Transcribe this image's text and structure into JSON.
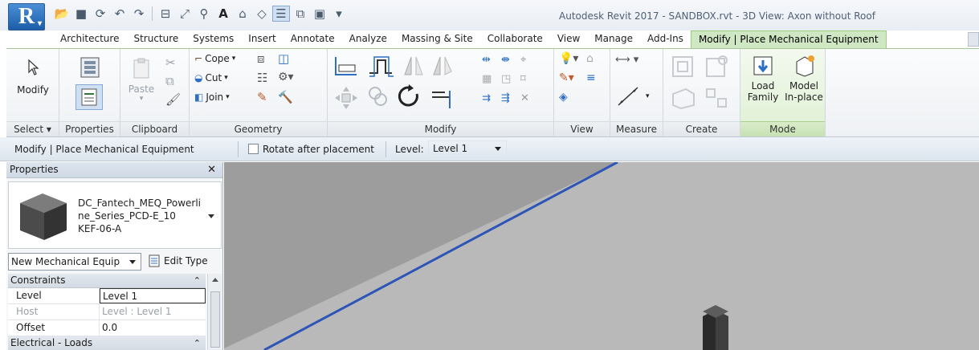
{
  "app": {
    "logo_letter": "R",
    "window_title": "Autodesk Revit 2017 -    SANDBOX.rvt - 3D View: Axon without Roof"
  },
  "quick_access": [
    "open-icon",
    "save-icon",
    "sync-icon",
    "undo-icon",
    "redo-icon",
    "measure-icon",
    "dimension-icon",
    "tag-icon",
    "text-icon",
    "3d-view-icon",
    "section-icon",
    "thin-lines-icon",
    "close-hidden-icon",
    "switch-windows-icon",
    "customize-icon"
  ],
  "tabs": [
    {
      "label": "Architecture"
    },
    {
      "label": "Structure"
    },
    {
      "label": "Systems"
    },
    {
      "label": "Insert"
    },
    {
      "label": "Annotate"
    },
    {
      "label": "Analyze"
    },
    {
      "label": "Massing & Site"
    },
    {
      "label": "Collaborate"
    },
    {
      "label": "View"
    },
    {
      "label": "Manage"
    },
    {
      "label": "Add-Ins"
    },
    {
      "label": "Modify | Place Mechanical Equipment"
    }
  ],
  "ribbon": {
    "select": {
      "button": "Modify",
      "title": "Select ▾"
    },
    "properties": {
      "title": "Properties"
    },
    "clipboard": {
      "paste": "Paste",
      "title": "Clipboard"
    },
    "geometry": {
      "cope": "Cope",
      "cut": "Cut",
      "join": "Join",
      "title": "Geometry"
    },
    "modify": {
      "title": "Modify"
    },
    "view": {
      "title": "View"
    },
    "measure": {
      "title": "Measure"
    },
    "create": {
      "title": "Create"
    },
    "mode": {
      "load_family_line1": "Load",
      "load_family_line2": "Family",
      "model_inplace_line1": "Model",
      "model_inplace_line2": "In-place",
      "title": "Mode"
    }
  },
  "options_bar": {
    "context": "Modify | Place Mechanical Equipment",
    "rotate_label": "Rotate after placement",
    "rotate_checked": false,
    "level_label": "Level:",
    "level_value": "Level 1"
  },
  "properties_palette": {
    "title": "Properties",
    "type_name_line1": "DC_Fantech_MEQ_Powerli",
    "type_name_line2": "ne_Series_PCD-E_10",
    "type_name_line3": "KEF-06-A",
    "filter": "New Mechanical Equip",
    "edit_type": "Edit Type",
    "groups": [
      {
        "name": "Constraints",
        "rows": [
          {
            "name": "Level",
            "value": "Level 1"
          },
          {
            "name": "Host",
            "value": "Level : Level 1"
          },
          {
            "name": "Offset",
            "value": "0.0"
          }
        ]
      },
      {
        "name": "Electrical - Loads",
        "rows": []
      }
    ]
  },
  "colors": {
    "active_tab": "#cfe7c3",
    "canvas_floor": "#b9b9b9",
    "canvas_wall": "#9d9d9d",
    "edge_blue": "#2d55b7"
  }
}
